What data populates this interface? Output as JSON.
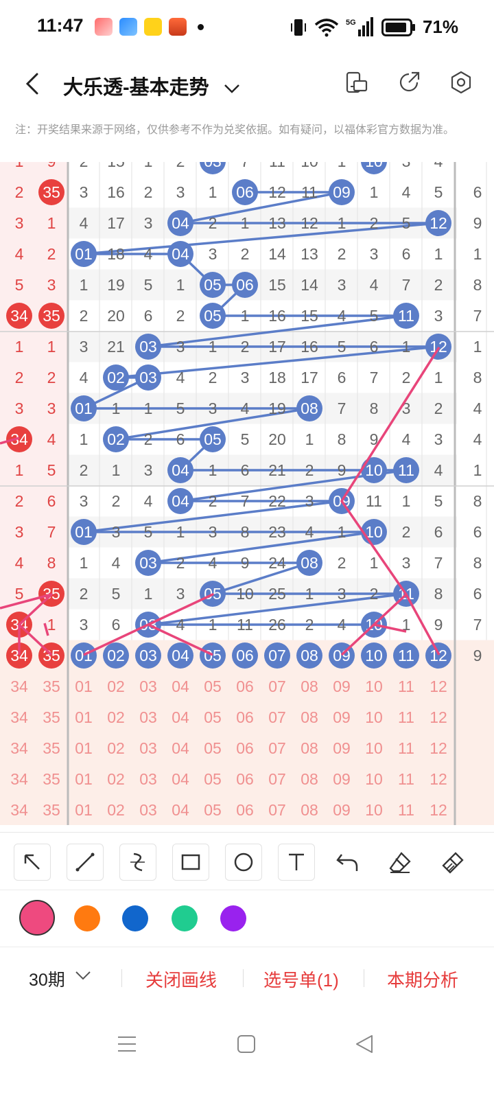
{
  "status": {
    "time": "11:47",
    "battery": "71%",
    "network": "5G",
    "app_icons": [
      "game-app-icon",
      "feather-app-icon",
      "cartoon-app-icon",
      "cake-app-icon"
    ]
  },
  "header": {
    "title": "大乐透-基本走势"
  },
  "note": "注：开奖结果来源于网络，仅供参考不作为兑奖依据。如有疑问，以福体彩官方数据为准。",
  "colors": {
    "blue_ball": "#5b7dc8",
    "red_ball": "#e8403e",
    "red_text": "#e04444",
    "gray_text": "#666666",
    "pink_line": "#e8457a",
    "pink_bg": "#fdeee8",
    "select_text": "#f09090"
  },
  "chart_data": {
    "type": "table",
    "columns_back_visible": [
      "34",
      "35"
    ],
    "columns_blue": [
      "01",
      "02",
      "03",
      "04",
      "05",
      "06",
      "07",
      "08",
      "09",
      "10",
      "11",
      "12"
    ],
    "top_partial_row": [
      "1",
      "9",
      "2",
      "15",
      "1",
      "2",
      "03",
      "7",
      "11",
      "10",
      "1",
      "10",
      "3",
      "4"
    ],
    "rows": [
      {
        "back": [
          "2",
          "35"
        ],
        "blue": [
          "3",
          "16",
          "2",
          "3",
          "1",
          "06",
          "12",
          "11",
          "09",
          "1",
          "4",
          "5"
        ]
      },
      {
        "back": [
          "3",
          "1"
        ],
        "blue": [
          "4",
          "17",
          "3",
          "04",
          "2",
          "1",
          "13",
          "12",
          "1",
          "2",
          "5",
          "12"
        ]
      },
      {
        "back": [
          "4",
          "2"
        ],
        "blue": [
          "01",
          "18",
          "4",
          "04",
          "3",
          "2",
          "14",
          "13",
          "2",
          "3",
          "6",
          "1"
        ]
      },
      {
        "back": [
          "5",
          "3"
        ],
        "blue": [
          "1",
          "19",
          "5",
          "1",
          "05",
          "06",
          "15",
          "14",
          "3",
          "4",
          "7",
          "2"
        ]
      },
      {
        "back": [
          "34",
          "35"
        ],
        "blue": [
          "2",
          "20",
          "6",
          "2",
          "05",
          "1",
          "16",
          "15",
          "4",
          "5",
          "11",
          "3"
        ]
      },
      {
        "back": [
          "1",
          "1"
        ],
        "blue": [
          "3",
          "21",
          "03",
          "3",
          "1",
          "2",
          "17",
          "16",
          "5",
          "6",
          "1",
          "12"
        ]
      },
      {
        "back": [
          "2",
          "2"
        ],
        "blue": [
          "4",
          "02",
          "03",
          "4",
          "2",
          "3",
          "18",
          "17",
          "6",
          "7",
          "2",
          "1"
        ]
      },
      {
        "back": [
          "3",
          "3"
        ],
        "blue": [
          "01",
          "1",
          "1",
          "5",
          "3",
          "4",
          "19",
          "08",
          "7",
          "8",
          "3",
          "2"
        ]
      },
      {
        "back": [
          "34",
          "4"
        ],
        "blue": [
          "1",
          "02",
          "2",
          "6",
          "05",
          "5",
          "20",
          "1",
          "8",
          "9",
          "4",
          "3"
        ]
      },
      {
        "back": [
          "1",
          "5"
        ],
        "blue": [
          "2",
          "1",
          "3",
          "04",
          "1",
          "6",
          "21",
          "2",
          "9",
          "10",
          "11",
          "4"
        ]
      },
      {
        "back": [
          "2",
          "6"
        ],
        "blue": [
          "3",
          "2",
          "4",
          "04",
          "2",
          "7",
          "22",
          "3",
          "09",
          "11",
          "1",
          "5"
        ]
      },
      {
        "back": [
          "3",
          "7"
        ],
        "blue": [
          "01",
          "3",
          "5",
          "1",
          "3",
          "8",
          "23",
          "4",
          "1",
          "10",
          "2",
          "6"
        ]
      },
      {
        "back": [
          "4",
          "8"
        ],
        "blue": [
          "1",
          "4",
          "03",
          "2",
          "4",
          "9",
          "24",
          "08",
          "2",
          "1",
          "3",
          "7"
        ]
      },
      {
        "back": [
          "5",
          "35"
        ],
        "blue": [
          "2",
          "5",
          "1",
          "3",
          "05",
          "10",
          "25",
          "1",
          "3",
          "2",
          "11",
          "8"
        ]
      },
      {
        "back": [
          "34",
          "1"
        ],
        "blue": [
          "3",
          "6",
          "03",
          "4",
          "1",
          "11",
          "26",
          "2",
          "4",
          "10",
          "1",
          "9"
        ]
      },
      {
        "back": [
          "34",
          "35"
        ],
        "blue": [
          "01",
          "02",
          "03",
          "04",
          "05",
          "06",
          "07",
          "08",
          "09",
          "10",
          "11",
          "12"
        ]
      }
    ],
    "right_edge_partial": [
      "6",
      "9",
      "1",
      "8",
      "7",
      "1",
      "8",
      "4",
      "4",
      "1",
      "8",
      "6",
      "8",
      "6",
      "7",
      "9"
    ],
    "selection_rows": 5
  },
  "toolbar": {
    "tools": [
      "arrow-tool-icon",
      "line-tool-icon",
      "curve-tool-icon",
      "rectangle-tool-icon",
      "circle-tool-icon",
      "text-tool-icon",
      "undo-icon",
      "eraser-icon",
      "clear-brush-icon"
    ]
  },
  "palette": [
    "#ee4a7f",
    "#ff7a10",
    "#1166cc",
    "#20cc90",
    "#9922ee"
  ],
  "bottom": {
    "period": "30期",
    "close_lines": "关闭画线",
    "pick_list": "选号单(1)",
    "analysis": "本期分析"
  }
}
